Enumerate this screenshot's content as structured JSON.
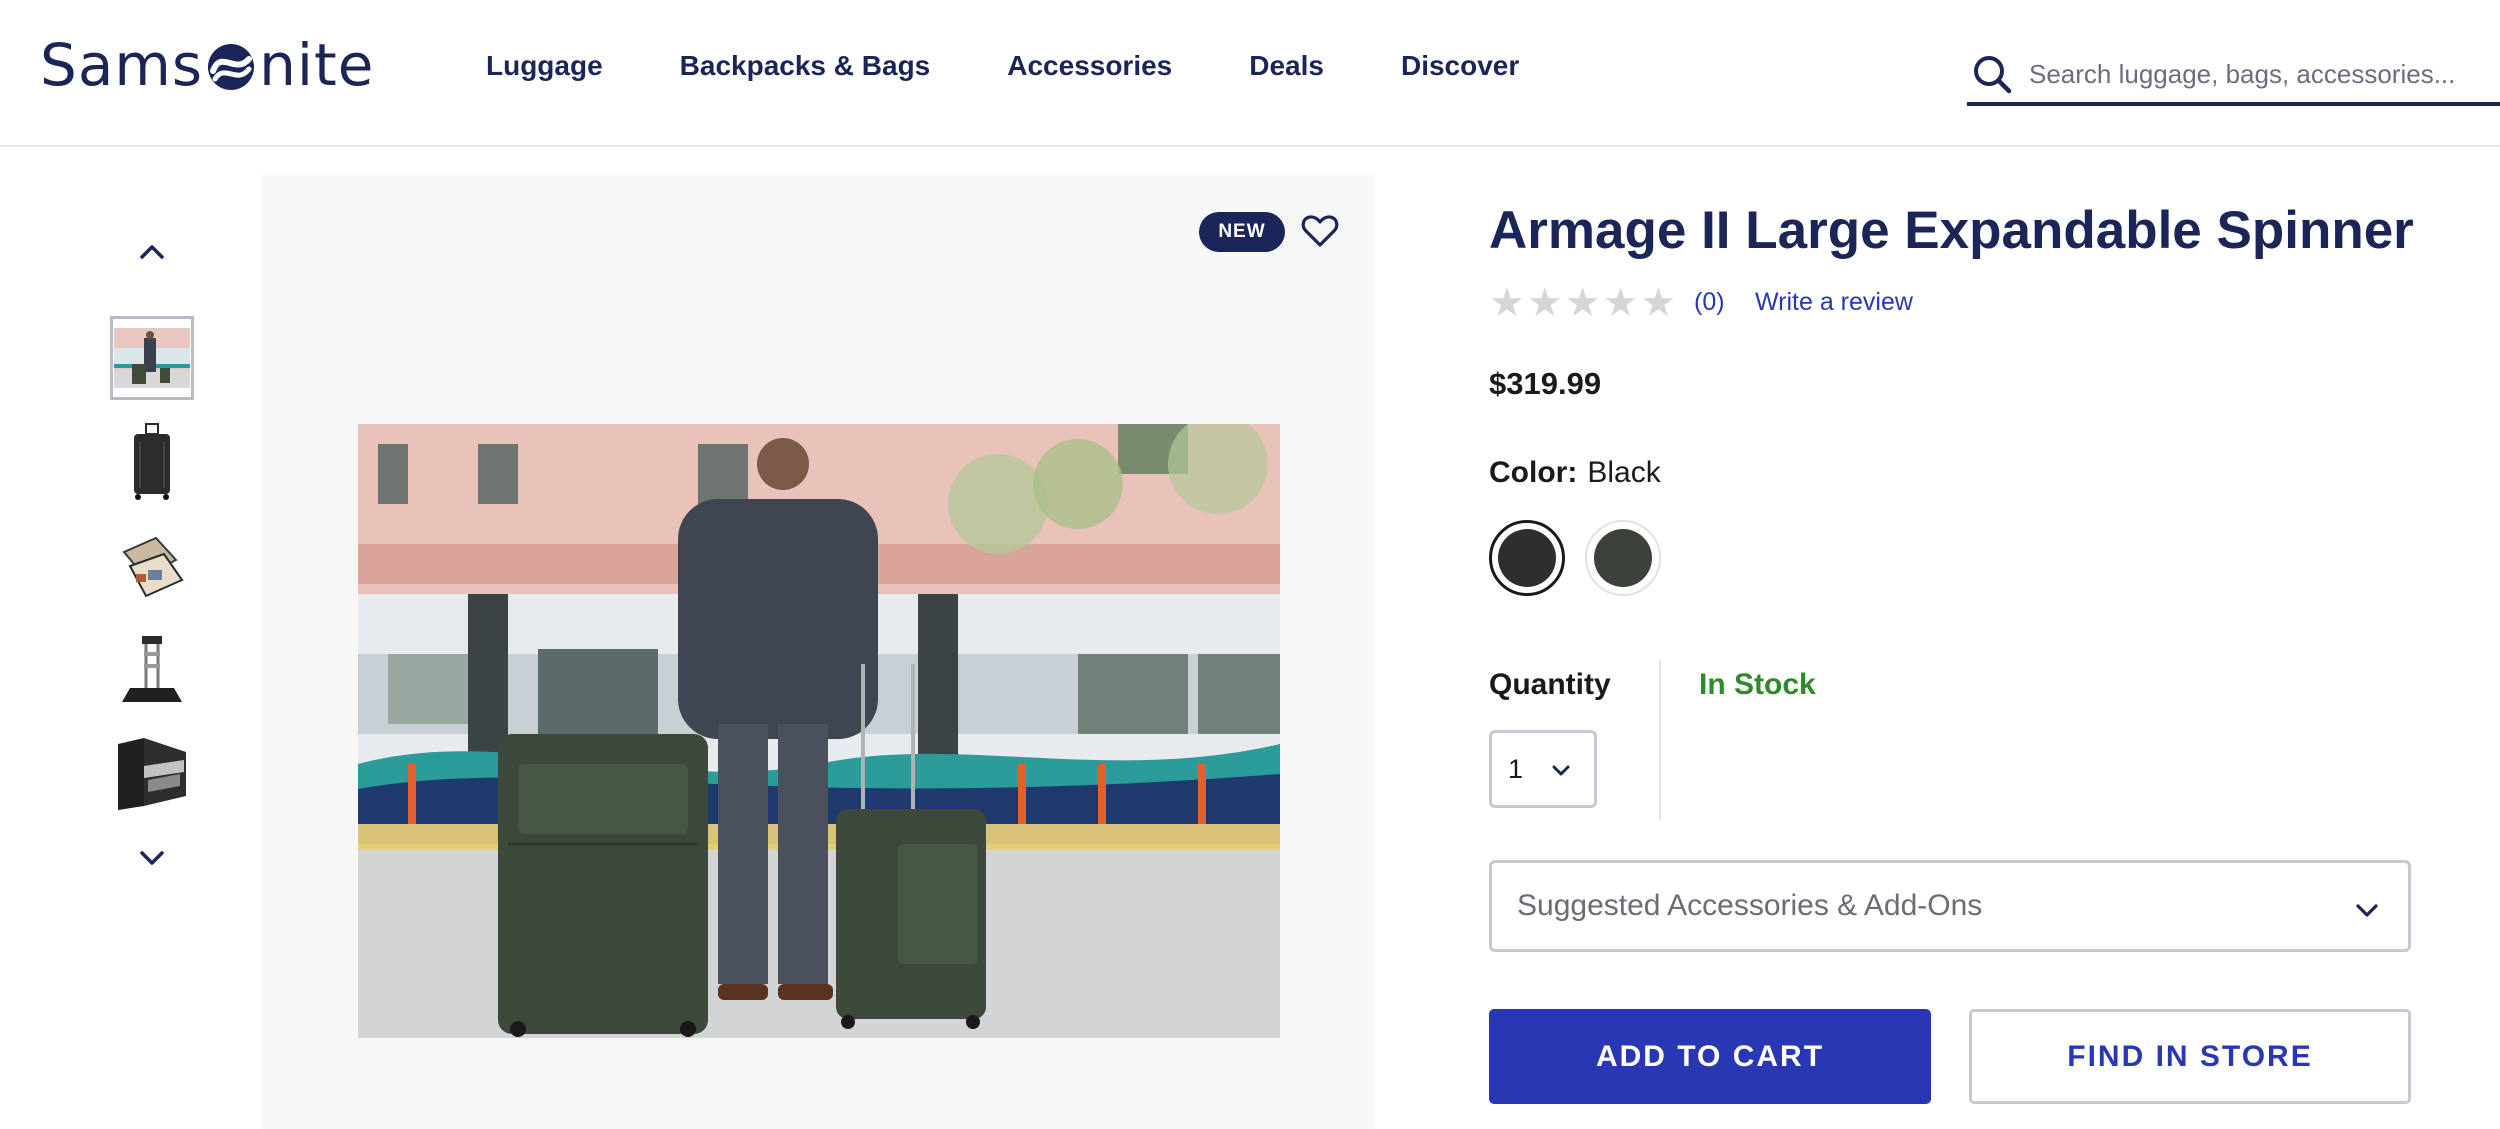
{
  "brand": {
    "logo_text_left": "Sams",
    "logo_text_right": "nite",
    "logo_icon": "samsonite-swirl-o"
  },
  "nav": {
    "items": [
      {
        "label": "Luggage"
      },
      {
        "label": "Backpacks & Bags"
      },
      {
        "label": "Accessories"
      },
      {
        "label": "Deals"
      },
      {
        "label": "Discover"
      }
    ]
  },
  "search": {
    "placeholder": "Search luggage, bags, accessories...",
    "value": "",
    "icon": "search-icon"
  },
  "gallery": {
    "up_icon": "chevron-up-icon",
    "down_icon": "chevron-down-icon",
    "active_index": 0,
    "badge": "NEW",
    "wishlist_icon": "heart-icon"
  },
  "product": {
    "title": "Armage II Large Expandable Spinner",
    "rating": 0,
    "max_rating": 5,
    "review_count": "(0)",
    "write_review": "Write a review",
    "price": "$319.99",
    "color_label": "Color:",
    "color_value": "Black",
    "colors": [
      {
        "name": "Black",
        "hex": "#2d2e30",
        "selected": true
      },
      {
        "name": "Green",
        "hex": "#3c423a",
        "selected": false
      }
    ],
    "quantity_label": "Quantity",
    "quantity_value": "1",
    "stock_status": "In Stock",
    "accessories_label": "Suggested Accessories & Add-Ons",
    "add_to_cart": "ADD TO CART",
    "find_in_store": "FIND IN STORE"
  },
  "colors": {
    "navy": "#1c2557",
    "accent_blue": "#2a37b5",
    "in_stock_green": "#2e8a2a",
    "panel_bg": "#f7f7f7"
  }
}
